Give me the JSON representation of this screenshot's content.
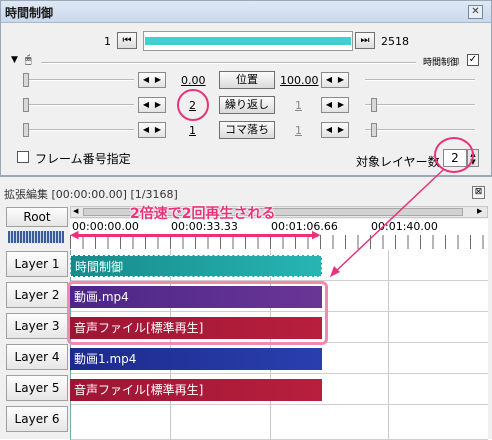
{
  "window": {
    "title": "時間制御",
    "close_label": "x"
  },
  "frame_bar": {
    "start": "1",
    "end": "2518"
  },
  "header_row": {
    "label": "時間制御",
    "checked": "✓"
  },
  "params": [
    {
      "value": "0.00",
      "button": "位置",
      "right_value": "100.00"
    },
    {
      "value": "2",
      "button": "繰り返し",
      "right_value": "1"
    },
    {
      "value": "1",
      "button": "コマ落ち",
      "right_value": "1"
    }
  ],
  "frame_number_label": "フレーム番号指定",
  "target_layers": {
    "label": "対象レイヤー数",
    "value": "2"
  },
  "timeline": {
    "title": "拡張編集 [00:00:00.00] [1/3168]",
    "root_label": "Root",
    "times": [
      "00:00:00.00",
      "00:00:33.33",
      "00:01:06.66",
      "00:01:40.00"
    ],
    "annotation": "2倍速で2回再生される",
    "layers": [
      "Layer 1",
      "Layer 2",
      "Layer 3",
      "Layer 4",
      "Layer 5",
      "Layer 6"
    ],
    "clips": [
      {
        "label": "時間制御",
        "color": "#1c9c9c"
      },
      {
        "label": "動画.mp4",
        "color": "#5a2a8c"
      },
      {
        "label": "音声ファイル[標準再生]",
        "color": "#a3183a"
      },
      {
        "label": "動画1.mp4",
        "color": "#1f2f96"
      },
      {
        "label": "音声ファイル[標準再生]",
        "color": "#a3183a"
      }
    ]
  },
  "colors": {
    "accent_pink": "#e8337a",
    "progress_teal": "#3fd0cf"
  }
}
